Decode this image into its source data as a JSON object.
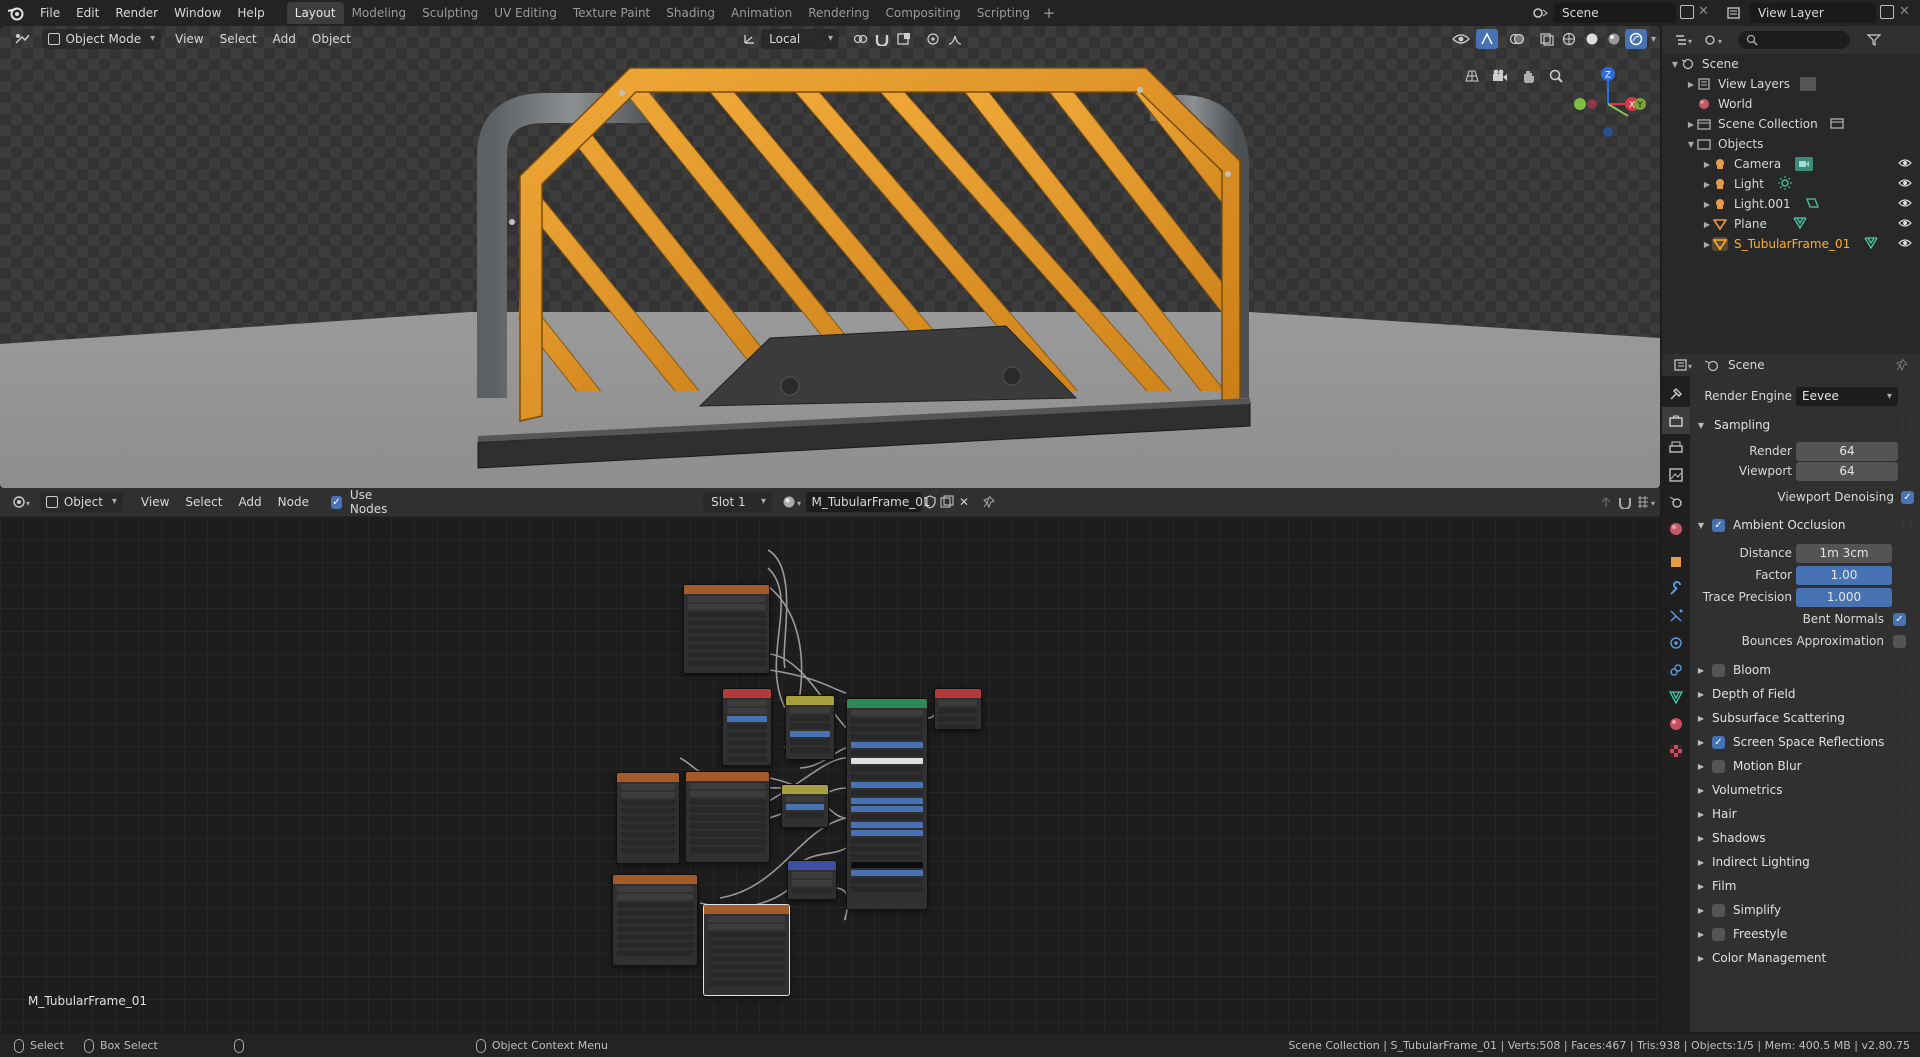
{
  "topbar": {
    "menus": [
      "File",
      "Edit",
      "Render",
      "Window",
      "Help"
    ],
    "workspaces": [
      "Layout",
      "Modeling",
      "Sculpting",
      "UV Editing",
      "Texture Paint",
      "Shading",
      "Animation",
      "Rendering",
      "Compositing",
      "Scripting"
    ],
    "active_workspace": "Layout",
    "scene_name": "Scene",
    "view_layer": "View Layer"
  },
  "viewport": {
    "mode": "Object Mode",
    "menus": [
      "View",
      "Select",
      "Add",
      "Object"
    ],
    "transform_orientation": "Local",
    "gizmo_axes": {
      "x": "X",
      "y": "Y",
      "z": "Z"
    }
  },
  "node_editor": {
    "type": "Object",
    "menus": [
      "View",
      "Select",
      "Add",
      "Node"
    ],
    "use_nodes_label": "Use Nodes",
    "slot": "Slot 1",
    "material": "M_TubularFrame_01",
    "overlay_label": "M_TubularFrame_01"
  },
  "outliner": {
    "rows": [
      {
        "label": "Scene"
      },
      {
        "label": "View Layers"
      },
      {
        "label": "World"
      },
      {
        "label": "Scene Collection"
      },
      {
        "label": "Objects"
      },
      {
        "label": "Camera"
      },
      {
        "label": "Light"
      },
      {
        "label": "Light.001"
      },
      {
        "label": "Plane"
      },
      {
        "label": "S_TubularFrame_01"
      }
    ]
  },
  "properties": {
    "context": "Scene",
    "render_engine_label": "Render Engine",
    "render_engine": "Eevee",
    "sampling": {
      "title": "Sampling",
      "render_label": "Render",
      "render": "64",
      "viewport_label": "Viewport",
      "viewport": "64",
      "denoise_label": "Viewport Denoising"
    },
    "ao": {
      "title": "Ambient Occlusion",
      "distance_label": "Distance",
      "distance": "1m 3cm",
      "factor_label": "Factor",
      "factor": "1.00",
      "trace_label": "Trace Precision",
      "trace": "1.000",
      "bent_label": "Bent Normals",
      "bounces_label": "Bounces Approximation"
    },
    "panels": [
      "Bloom",
      "Depth of Field",
      "Subsurface Scattering",
      "Screen Space Reflections",
      "Motion Blur",
      "Volumetrics",
      "Hair",
      "Shadows",
      "Indirect Lighting",
      "Film",
      "Simplify",
      "Freestyle",
      "Color Management"
    ]
  },
  "statusbar": {
    "select": "Select",
    "box_select": "Box Select",
    "context_menu": "Object Context Menu",
    "info": "Scene Collection | S_TubularFrame_01 | Verts:508 | Faces:467 | Tris:938 | Objects:1/5 | Mem: 400.5 MB | v2.80.75"
  },
  "colors": {
    "accent": "#4772b3",
    "selected_object": "#ffaf29",
    "frame_orange": "#e89a2a",
    "metal_dark": "#3a3b3a"
  }
}
